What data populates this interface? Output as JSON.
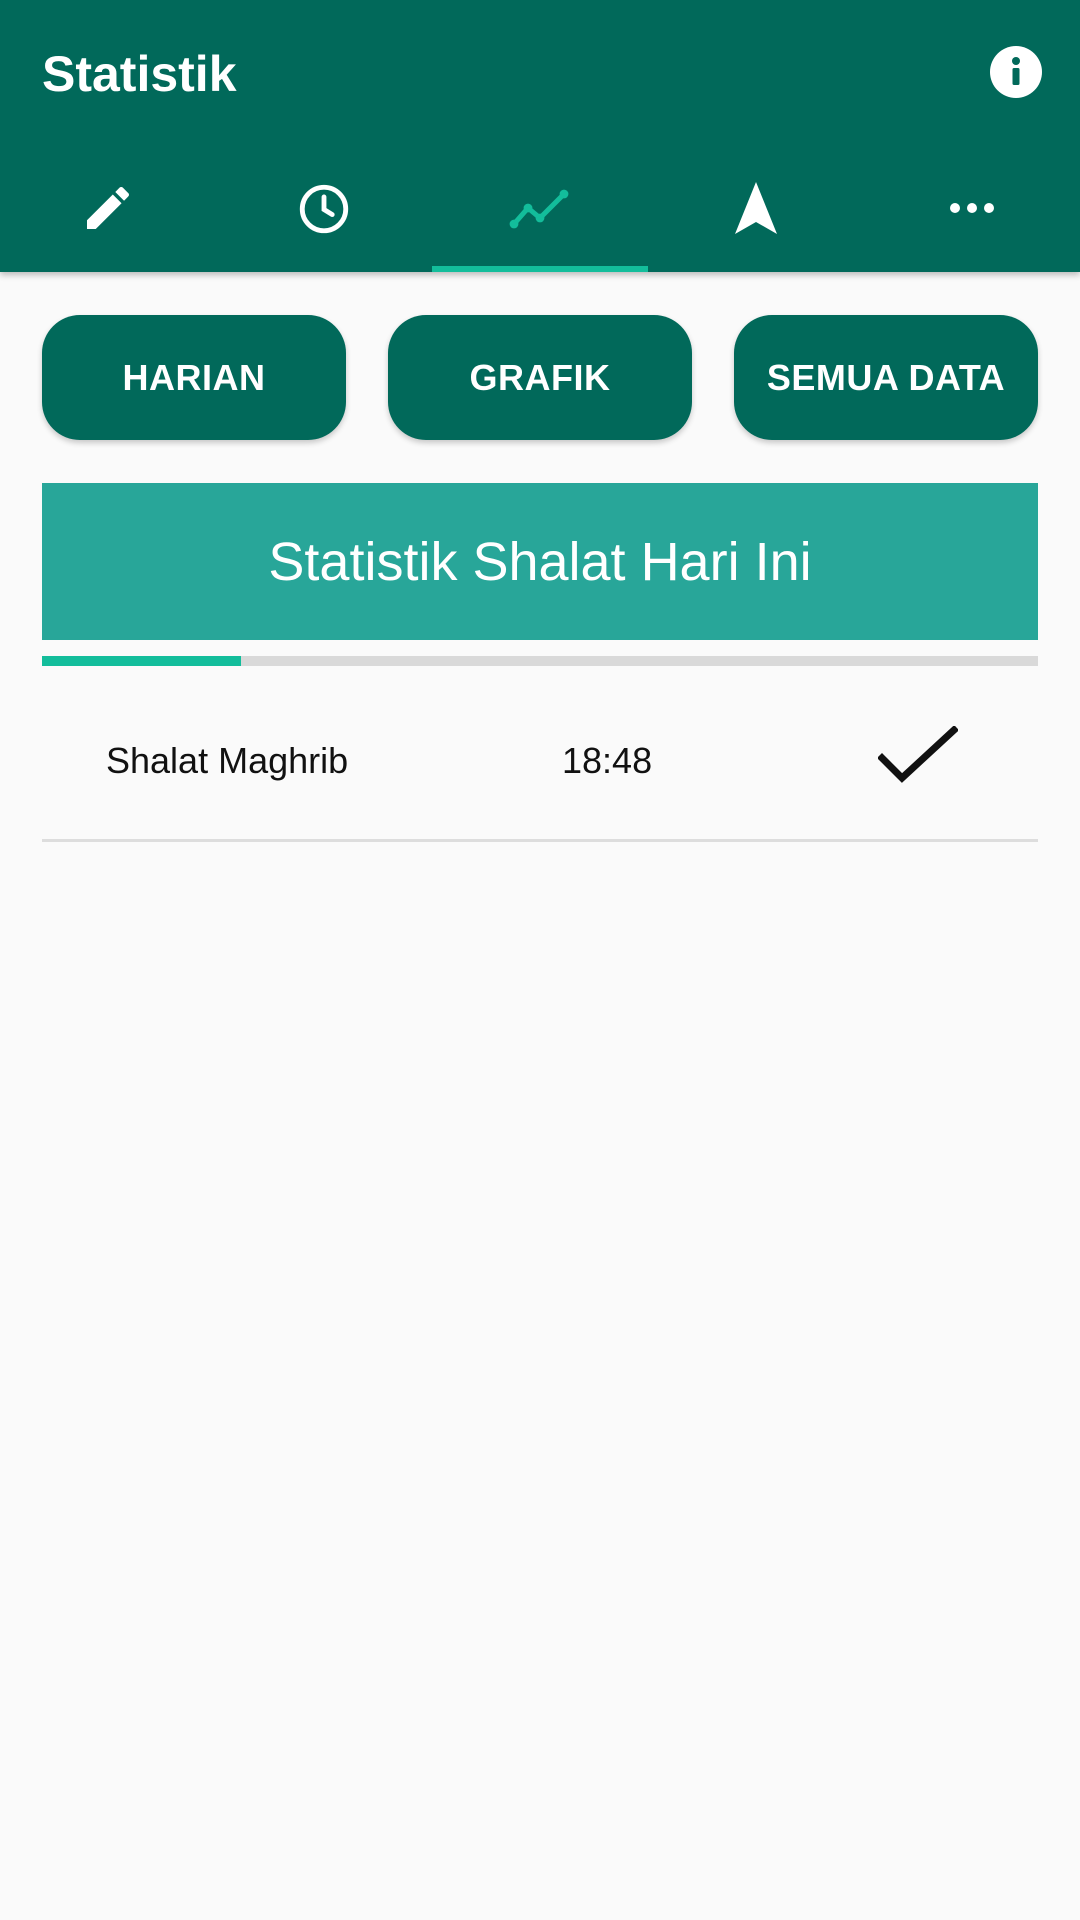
{
  "app": {
    "title": "Statistik",
    "info_icon": "info-icon",
    "accent": "#01695a",
    "indicator": "#13bd9b"
  },
  "tabs": [
    {
      "icon": "pencil-icon",
      "active": false
    },
    {
      "icon": "clock-icon",
      "active": false
    },
    {
      "icon": "chart-line-icon",
      "active": true
    },
    {
      "icon": "navigation-arrow-icon",
      "active": false
    },
    {
      "icon": "more-horizontal-icon",
      "active": false
    }
  ],
  "filters": {
    "harian": "HARIAN",
    "grafik": "GRAFIK",
    "semua_data": "SEMUA DATA"
  },
  "stats": {
    "title": "Statistik Shalat Hari Ini",
    "progress_fraction": 0.2,
    "header_color": "#28a699"
  },
  "rows": [
    {
      "name": "Shalat Maghrib",
      "time": "18:48",
      "status_icon": "check-icon"
    }
  ]
}
